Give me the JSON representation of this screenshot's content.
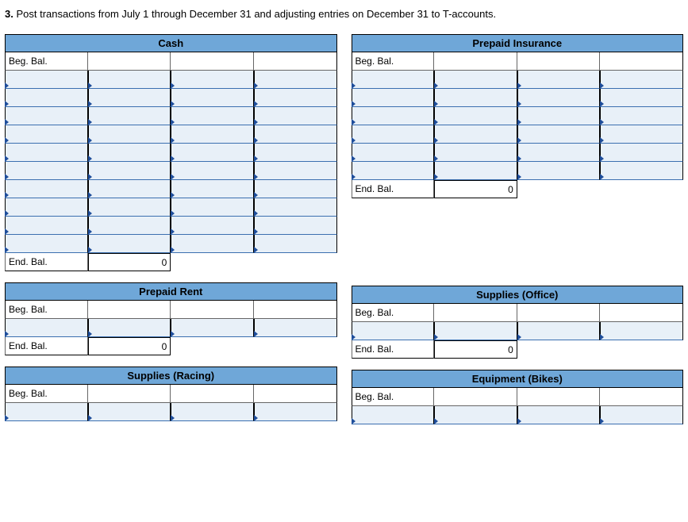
{
  "instruction_num": "3.",
  "instruction_text": "Post transactions from July 1 through December 31 and adjusting entries on December 31 to T-accounts.",
  "labels": {
    "beg_bal": "Beg. Bal.",
    "end_bal": "End. Bal."
  },
  "accounts": {
    "cash": {
      "title": "Cash",
      "entry_rows": 10,
      "end_bal": "0"
    },
    "prepaid_ins": {
      "title": "Prepaid Insurance",
      "entry_rows": 6,
      "end_bal": "0"
    },
    "prepaid_rent": {
      "title": "Prepaid Rent",
      "entry_rows": 1,
      "end_bal": "0"
    },
    "supplies_office": {
      "title": "Supplies (Office)",
      "entry_rows": 1,
      "end_bal": "0"
    },
    "supplies_racing": {
      "title": "Supplies (Racing)",
      "entry_rows": 0
    },
    "equipment_bikes": {
      "title": "Equipment (Bikes)",
      "entry_rows": 0
    }
  }
}
